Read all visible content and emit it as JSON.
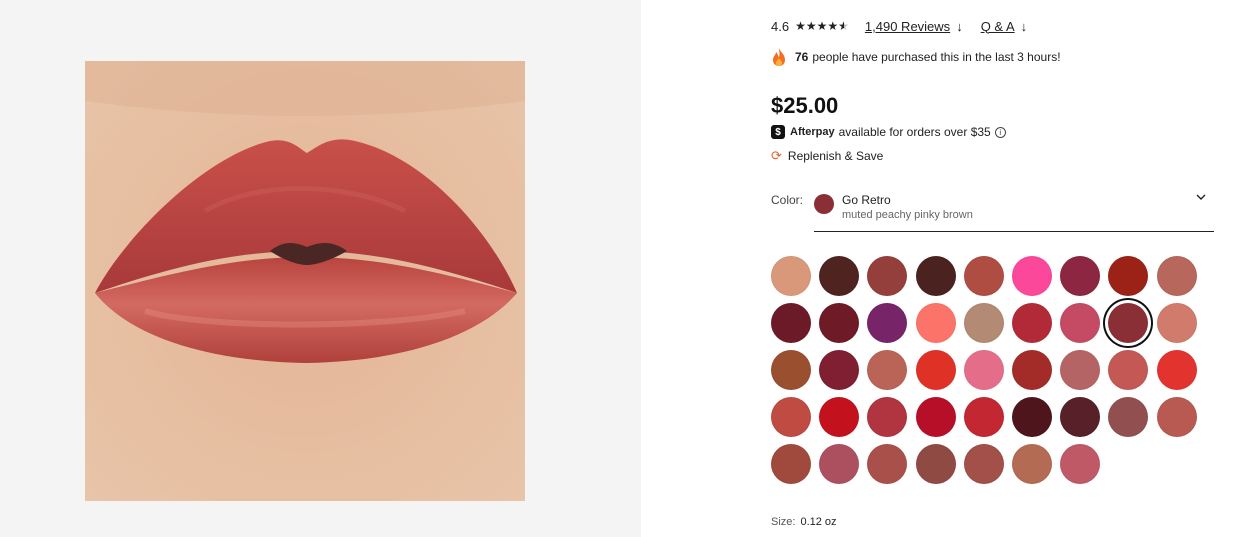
{
  "product": {
    "image_alt": "lip swatch"
  },
  "rating": {
    "value": "4.6",
    "stars": 4.6,
    "reviews_link": "1,490 Reviews",
    "qa_link": "Q & A"
  },
  "urgency": {
    "count": "76",
    "text": "people have purchased this in the last 3 hours!"
  },
  "price": "$25.00",
  "afterpay": {
    "name": "Afterpay",
    "text": "available for orders over $35"
  },
  "replenish": {
    "label": "Replenish & Save"
  },
  "color": {
    "label": "Color:",
    "selected_name": "Go Retro",
    "selected_desc": "muted peachy pinky brown",
    "selected_hex": "#8a2f35"
  },
  "swatches": [
    [
      "#d9987a",
      "#4e2320",
      "#953f3c",
      "#4a2321",
      "#b04d43",
      "#fb489b",
      "#8d2741",
      "#9c2217",
      "#b7675b"
    ],
    [
      "#6d1a28",
      "#6e1a27",
      "#772468",
      "#fc7469",
      "#b38a73",
      "#b22a38",
      "#c44b63",
      "#8a2f35",
      "#d17b6d"
    ],
    [
      "#9a4f2f",
      "#7f1f31",
      "#ba6458",
      "#e03127",
      "#e46e8a",
      "#a32c29",
      "#b56466",
      "#c35855",
      "#e3332f"
    ],
    [
      "#c04b42",
      "#c3121e",
      "#b13541",
      "#b80f28",
      "#c22732",
      "#4f151c",
      "#582028",
      "#91504f",
      "#b85a52"
    ],
    [
      "#9f4a3d",
      "#ac5060",
      "#a9504a",
      "#8f4a44",
      "#a25049",
      "#b46b53",
      "#bf5966"
    ]
  ],
  "selected_swatch": [
    1,
    7
  ],
  "size": {
    "label": "Size:",
    "value": "0.12 oz"
  }
}
